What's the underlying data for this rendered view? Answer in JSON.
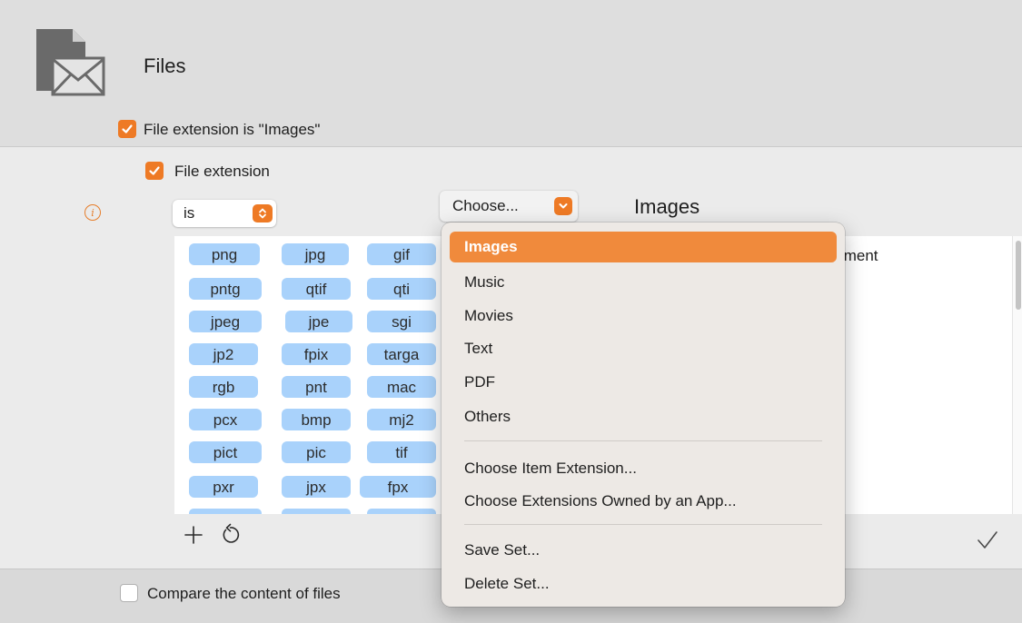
{
  "header": {
    "title": "Files",
    "rule_label": "File extension is \"Images\""
  },
  "criterion": {
    "label": "File extension",
    "operator": "is",
    "choose_label": "Choose...",
    "selected_set": "Images"
  },
  "extensions": [
    [
      "png",
      "jpg",
      "gif"
    ],
    [
      "pntg",
      "qtif",
      "qti"
    ],
    [
      "jpeg",
      "jpe",
      "sgi"
    ],
    [
      "jp2",
      "fpix",
      "targa"
    ],
    [
      "rgb",
      "pnt",
      "mac"
    ],
    [
      "pcx",
      "bmp",
      "mj2"
    ],
    [
      "pict",
      "pic",
      "tif"
    ],
    [
      "pxr",
      "jpx",
      "fpx"
    ]
  ],
  "description_fragment": "ıment",
  "menu": {
    "sets": [
      "Images",
      "Music",
      "Movies",
      "Text",
      "PDF",
      "Others"
    ],
    "extension_actions": [
      "Choose Item Extension...",
      "Choose Extensions Owned by an App..."
    ],
    "set_actions": [
      "Save Set...",
      "Delete Set..."
    ]
  },
  "footer": {
    "compare_label": "Compare the content of files"
  },
  "colors": {
    "accent": "#ee7a25",
    "tag_fill": "#a9d2fb",
    "menu_highlight": "#f08a3c"
  }
}
